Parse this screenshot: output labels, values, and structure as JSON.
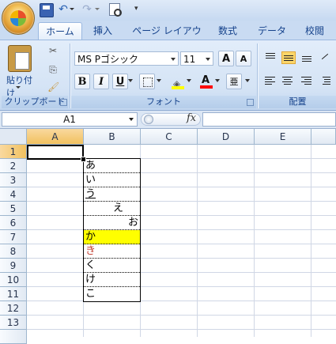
{
  "qat": {
    "customize_glyph": "▾"
  },
  "tabs": [
    "ホーム",
    "挿入",
    "ページ レイアウト",
    "数式",
    "データ",
    "校閲"
  ],
  "clipboard": {
    "paste_label": "貼り付け",
    "group_label": "クリップボード"
  },
  "font": {
    "name": "MS Pゴシック",
    "size": "11",
    "grow_label": "A",
    "shrink_label": "A",
    "bold": "B",
    "italic": "I",
    "underline": "U",
    "font_color_label": "A",
    "font_color": "#ff0000",
    "fill_color": "#ffff00",
    "phonetic_label": "亜",
    "group_label": "フォント"
  },
  "alignment": {
    "group_label": "配置"
  },
  "formula_bar": {
    "cell_ref": "A1",
    "fx_label": "fx",
    "value": ""
  },
  "columns": [
    "A",
    "B",
    "C",
    "D",
    "E"
  ],
  "rows": [
    "1",
    "2",
    "3",
    "4",
    "5",
    "6",
    "7",
    "8",
    "9",
    "10",
    "11",
    "12",
    "13"
  ],
  "selected_cell": "A1",
  "cells": {
    "b2": "あ",
    "b3": "い",
    "b4": "う",
    "b5": "え",
    "b6": "お",
    "b7": "か",
    "b8": "き",
    "b9": "く",
    "b10": "け",
    "b11": "こ"
  },
  "colors": {
    "highlight_fill": "#ffff00",
    "red_text": "#c0392b",
    "selection": "#f1c15f"
  }
}
